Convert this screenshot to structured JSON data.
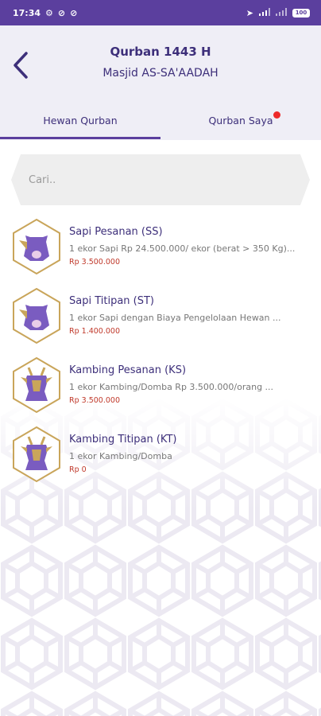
{
  "status_bar": {
    "time": "17:34",
    "battery": "100"
  },
  "header": {
    "title": "Qurban 1443 H",
    "subtitle": "Masjid AS-SA'AADAH"
  },
  "tabs": [
    {
      "label": "Hewan Qurban",
      "active": true
    },
    {
      "label": "Qurban Saya",
      "active": false,
      "badge": true
    }
  ],
  "search": {
    "placeholder": "Cari.."
  },
  "items": [
    {
      "name": "Sapi Pesanan (SS)",
      "description": "1 ekor Sapi Rp 24.500.000/ ekor (berat > 350 Kg)...",
      "price": "Rp 3.500.000",
      "icon": "cow-icon"
    },
    {
      "name": "Sapi Titipan (ST)",
      "description": "1 ekor Sapi dengan Biaya Pengelolaan Hewan ...",
      "price": "Rp 1.400.000",
      "icon": "cow-icon"
    },
    {
      "name": "Kambing Pesanan (KS)",
      "description": "1 ekor Kambing/Domba Rp 3.500.000/orang ...",
      "price": "Rp 3.500.000",
      "icon": "goat-icon"
    },
    {
      "name": "Kambing Titipan (KT)",
      "description": "1 ekor Kambing/Domba",
      "price": "Rp 0",
      "icon": "goat-icon"
    }
  ],
  "colors": {
    "primary": "#5b3f9e",
    "header_bg": "#efeef6",
    "price": "#c0392b",
    "badge": "#ee2a2a",
    "gold": "#c9a55a"
  }
}
